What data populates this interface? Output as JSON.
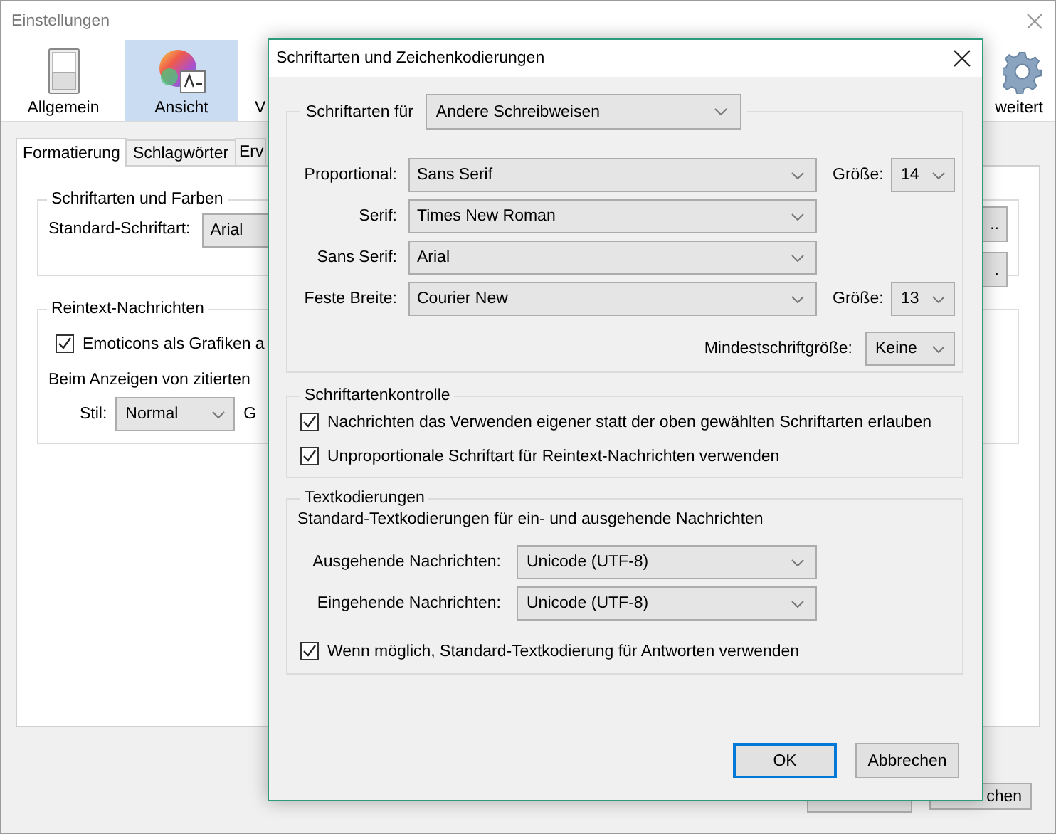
{
  "window": {
    "title": "Einstellungen"
  },
  "toolbar": [
    {
      "kind": "switch",
      "label": "Allgemein",
      "selected": false
    },
    {
      "kind": "palette",
      "label": "Ansicht",
      "selected": true
    },
    {
      "kind": "none",
      "label": "V",
      "selected": false
    },
    {
      "kind": "gear",
      "label": "weitert",
      "selected": false
    }
  ],
  "tabs": [
    {
      "label": "Formatierung",
      "selected": true
    },
    {
      "label": "Schlagwörter",
      "selected": false
    },
    {
      "label": "Erv",
      "selected": false
    }
  ],
  "fonts_colors": {
    "legend": "Schriftarten und Farben",
    "label": "Standard-Schriftart:",
    "value": "Arial",
    "buttons": [
      "..",
      "."
    ]
  },
  "plain_text": {
    "legend": "Reintext-Nachrichten",
    "emoticons": {
      "label": "Emoticons als Grafiken a",
      "checked": true
    },
    "quote_text": "Beim Anzeigen von zitierten",
    "style_label": "Stil:",
    "style_value": "Normal",
    "size_label": "G"
  },
  "footer_buttons": [
    "chen"
  ],
  "dialog": {
    "title": "Schriftarten und Zeichenkodierungen",
    "fonts_for": {
      "label": "Schriftarten für",
      "value": "Andere Schreibweisen"
    },
    "fonts": [
      {
        "label": "Proportional:",
        "value": "Sans Serif",
        "size_label": "Größe:",
        "size": "14"
      },
      {
        "label": "Serif:",
        "value": "Times New Roman"
      },
      {
        "label": "Sans Serif:",
        "value": "Arial"
      },
      {
        "label": "Feste Breite:",
        "value": "Courier New",
        "size_label": "Größe:",
        "size": "13"
      }
    ],
    "min_size": {
      "label": "Mindestschriftgröße:",
      "value": "Keine"
    },
    "font_control": {
      "legend": "Schriftartenkontrolle",
      "options": [
        {
          "label": "Nachrichten das Verwenden eigener statt der oben gewählten Schriftarten erlauben",
          "checked": true
        },
        {
          "label": "Unproportionale Schriftart für Reintext-Nachrichten verwenden",
          "checked": true
        }
      ]
    },
    "encodings": {
      "legend": "Textkodierungen",
      "description": "Standard-Textkodierungen für ein- und ausgehende Nachrichten",
      "rows": [
        {
          "label": "Ausgehende Nachrichten:",
          "value": "Unicode (UTF-8)"
        },
        {
          "label": "Eingehende Nachrichten:",
          "value": "Unicode (UTF-8)"
        }
      ],
      "reply_default": {
        "label": "Wenn möglich, Standard-Textkodierung für Antworten verwenden",
        "checked": true
      }
    },
    "buttons": [
      {
        "label": "OK",
        "default": true
      },
      {
        "label": "Abbrechen",
        "default": false
      }
    ]
  }
}
